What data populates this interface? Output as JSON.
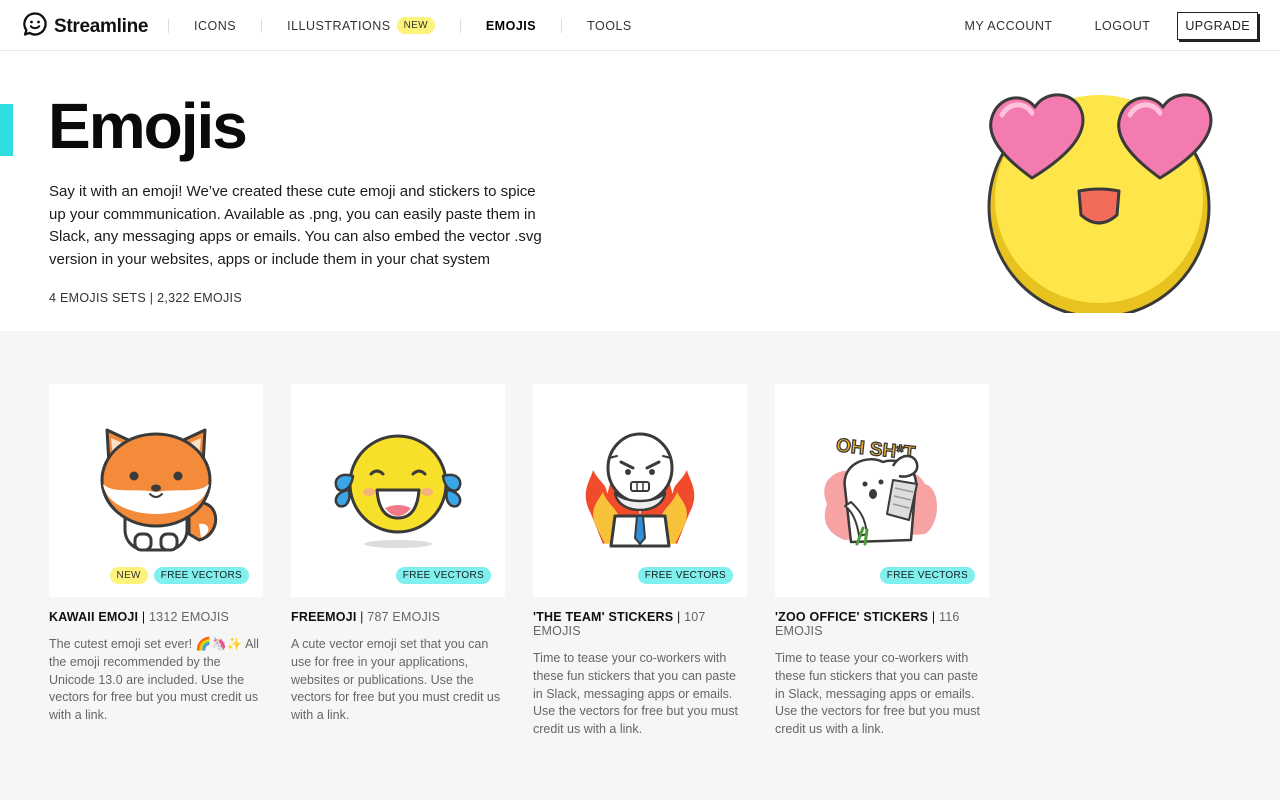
{
  "nav": {
    "logo": "Streamline",
    "links": [
      {
        "label": "ICONS"
      },
      {
        "label": "ILLUSTRATIONS",
        "badge": "NEW"
      },
      {
        "label": "EMOJIS",
        "active": true
      },
      {
        "label": "TOOLS"
      }
    ],
    "my_account": "MY ACCOUNT",
    "logout": "LOGOUT",
    "upgrade": "UPGRADE"
  },
  "hero": {
    "title": "Emojis",
    "description": "Say it with an emoji! We’ve created these cute emoji and stickers to spice up your commmunication. Available as .png, you can easily paste them in Slack, any messaging apps or emails. You can also embed the vector .svg version in your websites, apps or include them in your chat system",
    "meta": "4 EMOJIS SETS | 2,322 EMOJIS",
    "illustration": "heart-eyes-emoji"
  },
  "cards": [
    {
      "name": "KAWAII EMOJI",
      "count": "1312 EMOJIS",
      "description": "The cutest emoji set ever! 🌈🦄✨ All the emoji recommended by the Unicode 13.0 are included. Use the vectors for free but you must credit us with a link.",
      "badges": [
        "NEW",
        "FREE VECTORS"
      ],
      "illustration": "fox-emoji"
    },
    {
      "name": "FREEMOJI",
      "count": "787 EMOJIS",
      "description": "A cute vector emoji set that you can use for free in your applications, websites or publications. Use the vectors for free but you must credit us with a link.",
      "badges": [
        "FREE VECTORS"
      ],
      "illustration": "crying-laughing-emoji"
    },
    {
      "name": "'THE TEAM' STICKERS",
      "count": "107 EMOJIS",
      "description": "Time to tease your co-workers with these fun stickers that you can paste in Slack, messaging apps or emails. Use the vectors for free but you must credit us with a link.",
      "badges": [
        "FREE VECTORS"
      ],
      "illustration": "angry-boss-sticker"
    },
    {
      "name": "'ZOO OFFICE' STICKERS",
      "count": "116 EMOJIS",
      "description": "Time to tease your co-workers with these fun stickers that you can paste in Slack, messaging apps or emails. Use the vectors for free but you must credit us with a link.",
      "badges": [
        "FREE VECTORS"
      ],
      "illustration": "oh-sh-t-bunny-sticker",
      "sticker_text": "OH SH*T"
    }
  ],
  "colors": {
    "accent": "#2fdde0",
    "badge_new": "#fdf27a",
    "badge_free": "#7ff0ee"
  }
}
